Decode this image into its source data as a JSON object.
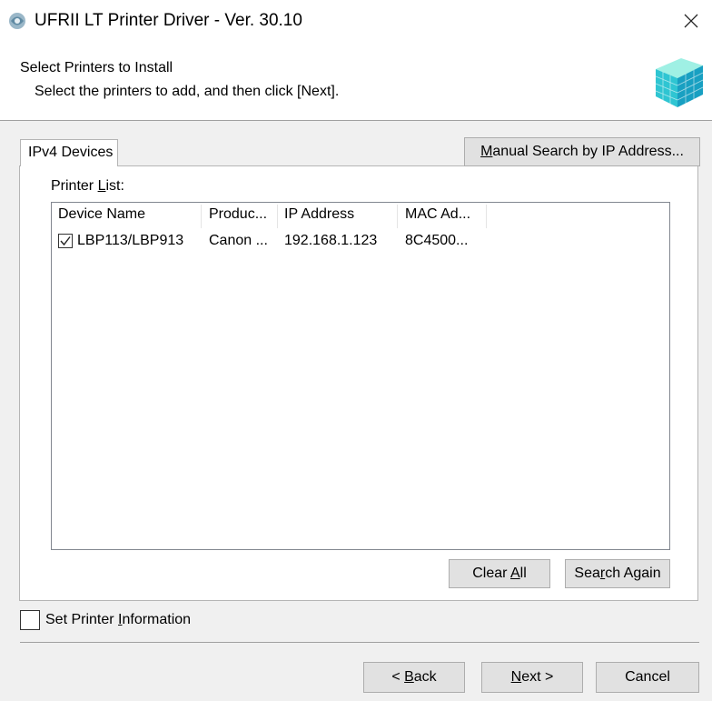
{
  "window": {
    "title": "UFRII LT Printer Driver - Ver. 30.10",
    "close_glyph": "✕"
  },
  "header": {
    "title": "Select Printers to Install",
    "subtitle": "Select the printers to add, and then click [Next]."
  },
  "tabs": [
    {
      "label": "IPv4 Devices"
    }
  ],
  "manual_search": {
    "label_mnemonic": "M",
    "label_rest": "anual Search by IP Address..."
  },
  "printer_list": {
    "label_before": "Printer ",
    "label_mnemonic": "L",
    "label_after": "ist:",
    "columns": [
      "Device Name",
      "Produc...",
      "IP Address",
      "MAC Ad..."
    ],
    "rows": [
      {
        "checked": true,
        "cells": [
          "LBP113/LBP913",
          "Canon ...",
          "192.168.1.123",
          "8C4500..."
        ]
      }
    ]
  },
  "clear_all": {
    "before": "Clear ",
    "mnemonic": "A",
    "after": "ll"
  },
  "search_again": {
    "before": "Sea",
    "mnemonic": "r",
    "after": "ch Again"
  },
  "set_printer_info": {
    "checked": false,
    "before": "Set Printer ",
    "mnemonic": "I",
    "after": "nformation"
  },
  "footer": {
    "back": {
      "before": "< ",
      "mnemonic": "B",
      "after": "ack"
    },
    "next": {
      "before": "",
      "mnemonic": "N",
      "after": "ext >"
    },
    "cancel": "Cancel"
  }
}
